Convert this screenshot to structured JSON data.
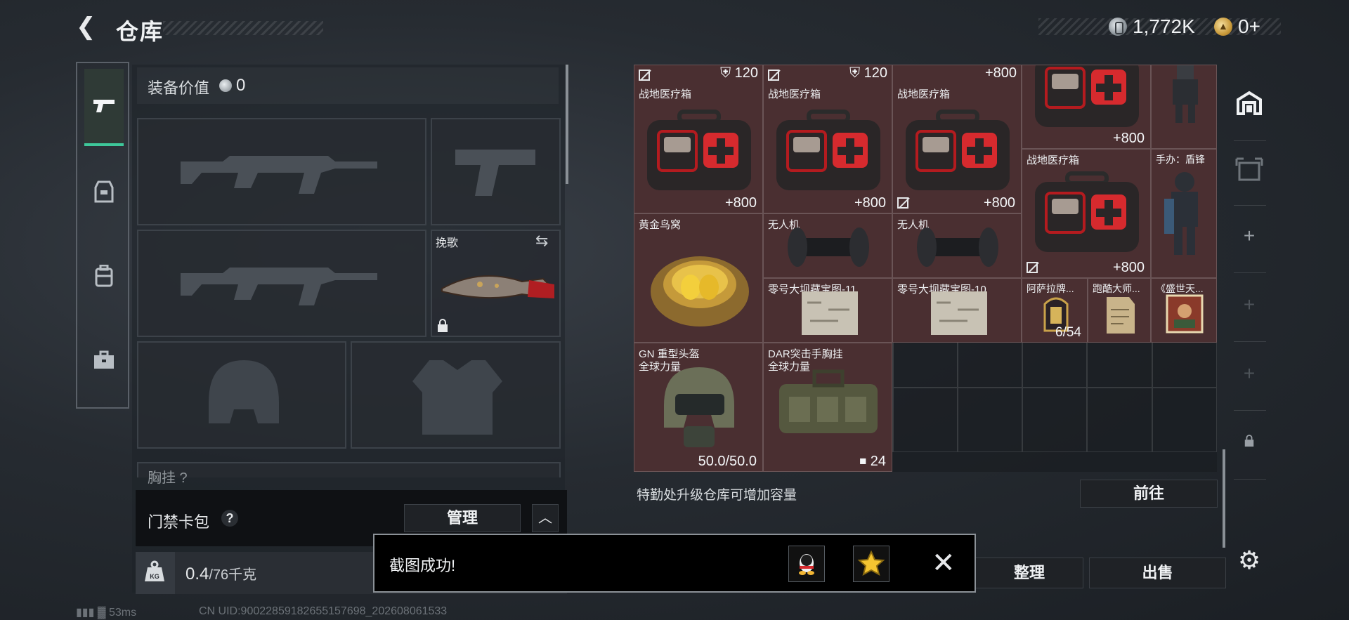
{
  "header": {
    "title": "仓库",
    "currency": {
      "silver": "1,772K",
      "gold": "0+"
    }
  },
  "equipment": {
    "value_label": "装备价值",
    "value": "0",
    "melee_name": "挽歌",
    "chestrig_label": "胸挂 ?"
  },
  "keycard": {
    "label": "门禁卡包",
    "help": "?",
    "manage": "管理",
    "collapse": "︿"
  },
  "weight": {
    "current": "0.4",
    "max": "/76千克"
  },
  "inventory": {
    "items": [
      {
        "name": "战地医疗箱",
        "value": "+800",
        "top_value": "120",
        "top_icon": "shield-icon"
      },
      {
        "name": "战地医疗箱",
        "value": "+800",
        "top_value": "120",
        "top_icon": "shield-icon"
      },
      {
        "name": "战地医疗箱",
        "value": "+800",
        "top_value": "+800"
      },
      {
        "name": "",
        "value": "+800"
      },
      {
        "name": ""
      },
      {
        "name": "战地医疗箱",
        "value": "+800"
      },
      {
        "name": "手办：盾锋"
      },
      {
        "name": "黄金鸟窝"
      },
      {
        "name": "无人机"
      },
      {
        "name": "无人机"
      },
      {
        "name": "零号大坝藏宝图-11"
      },
      {
        "name": "零号大坝藏宝图-10"
      },
      {
        "name": "阿萨拉牌...",
        "value": "6/54"
      },
      {
        "name": "跑酷大师..."
      },
      {
        "name": "《盛世天..."
      },
      {
        "name": "GN 重型头盔",
        "sub": "全球力量",
        "value": "50.0/50.0"
      },
      {
        "name": "DAR突击手胸挂",
        "sub": "全球力量",
        "value": "24"
      }
    ],
    "upgrade_note": "特勤处升级仓库可增加容量",
    "goto": "前往",
    "sort": "整理",
    "sell": "出售"
  },
  "toast": {
    "text": "截图成功!"
  },
  "status": {
    "ping": "53ms",
    "uid": "CN UID:90022859182655157698_202608061533"
  },
  "colors": {
    "accent": "#3ec79a",
    "item_bg": "#4a2f31",
    "panel": "#1f2226"
  }
}
